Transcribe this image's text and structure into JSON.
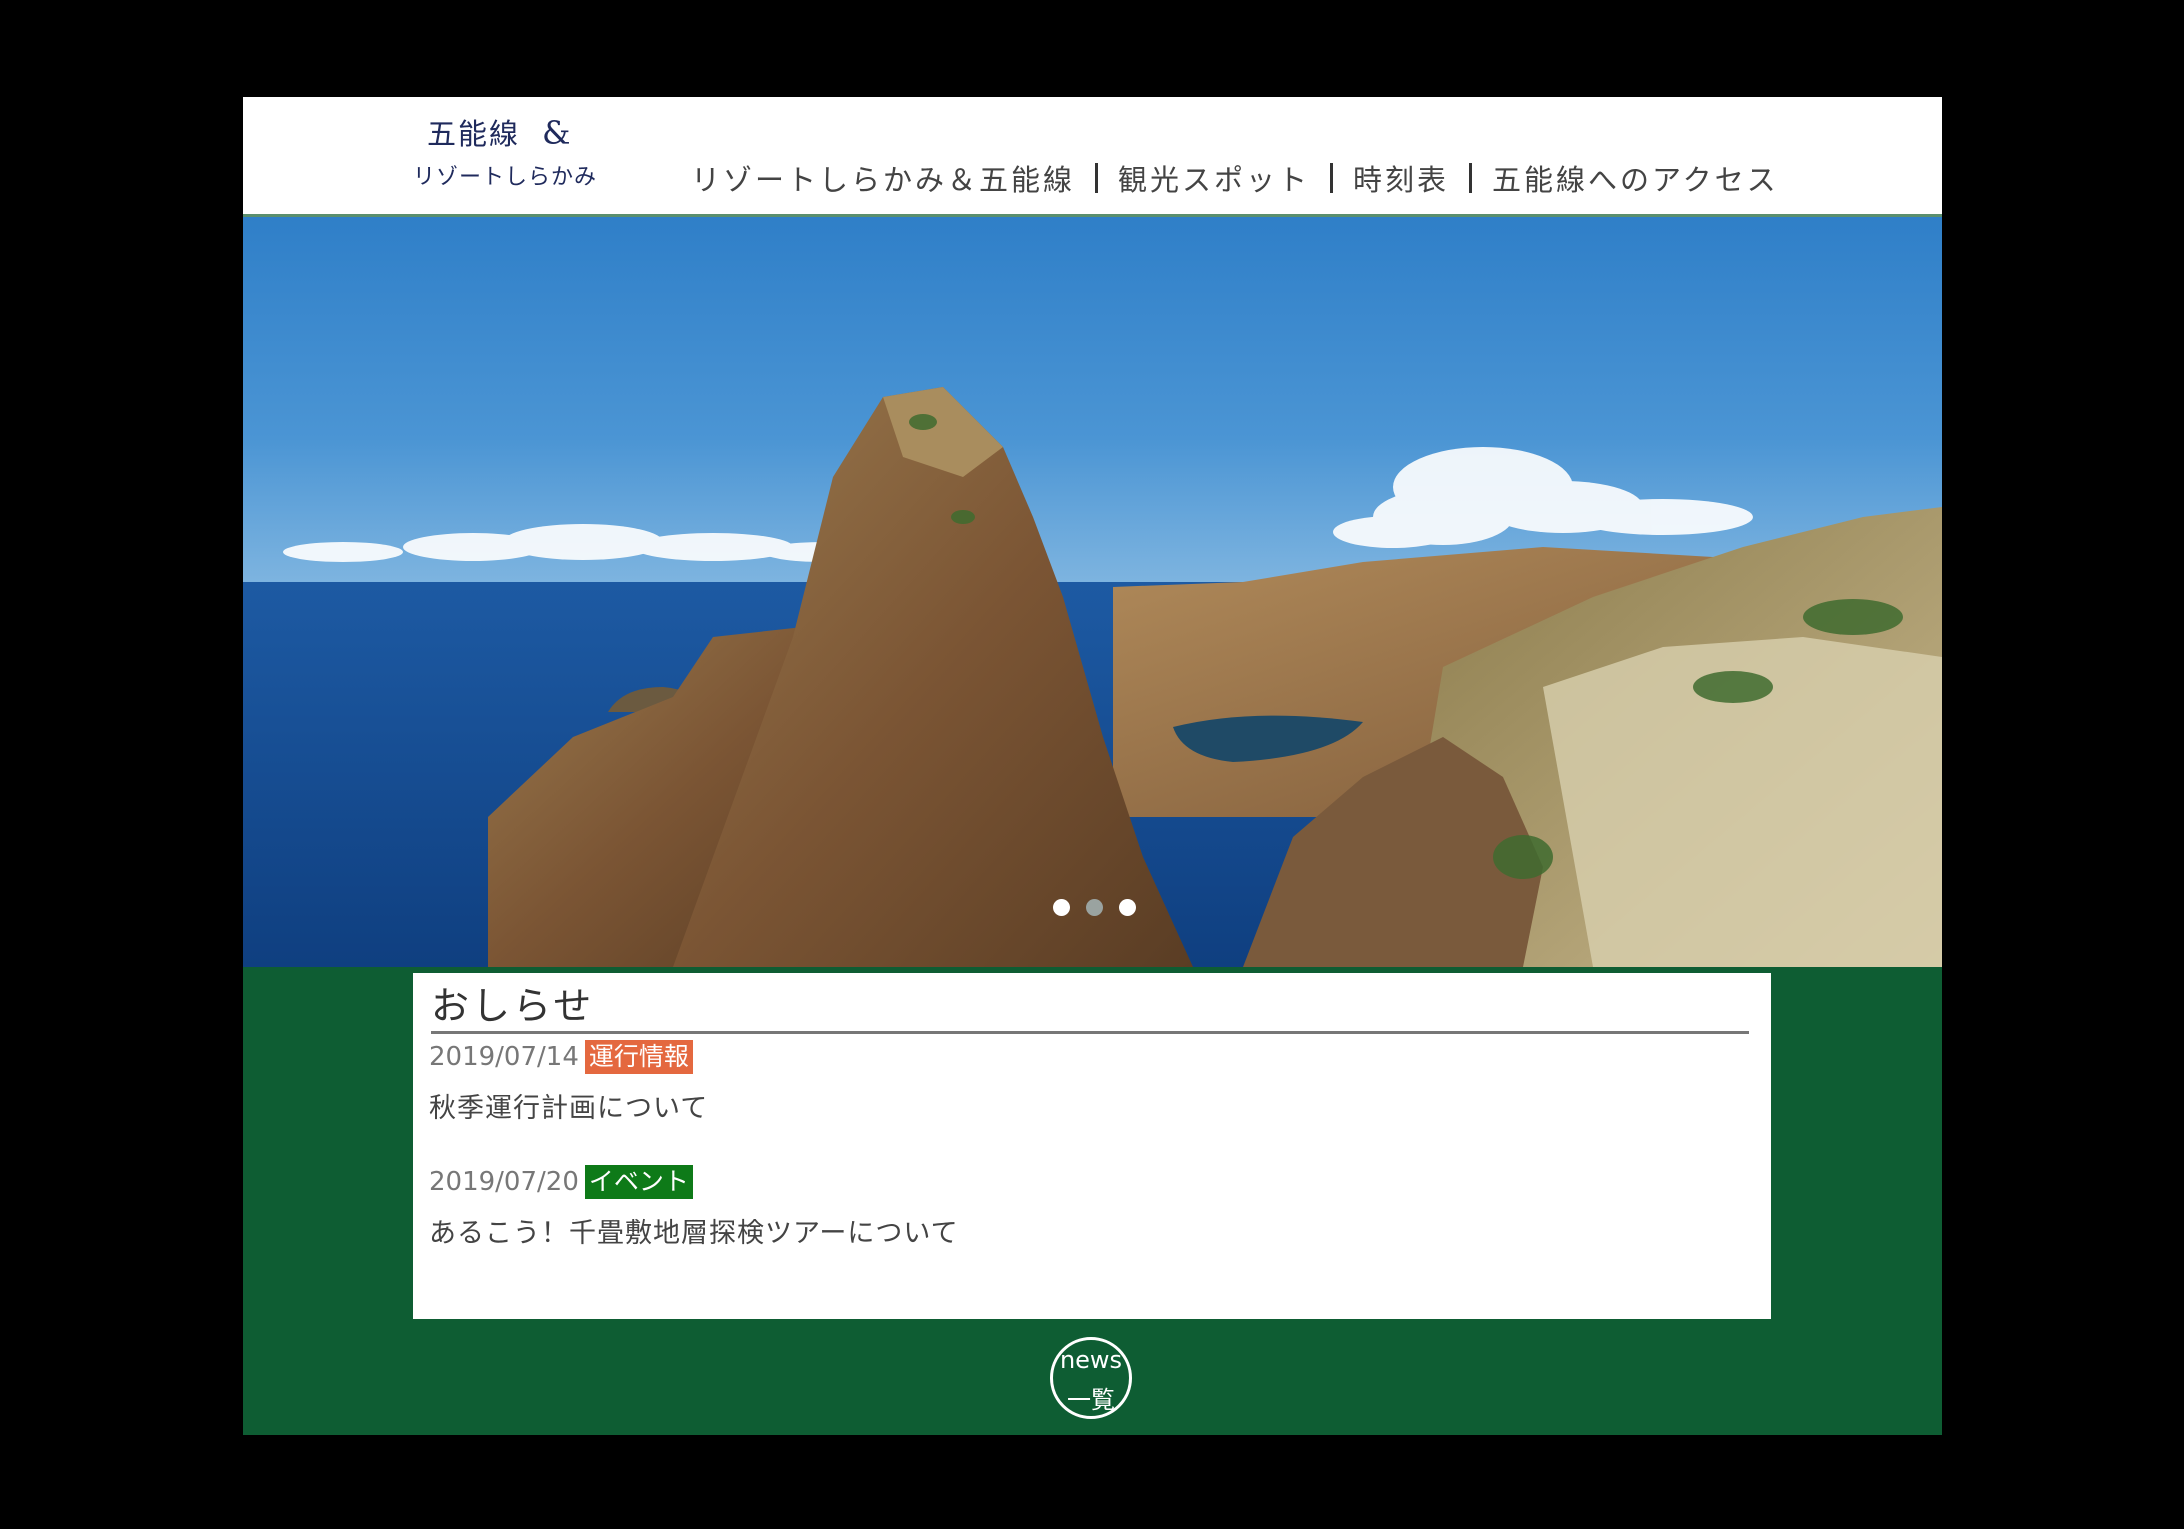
{
  "logo": {
    "line1": "五能線",
    "amp": "&",
    "line2": "リゾートしらかみ"
  },
  "nav": {
    "items": [
      {
        "label": "リゾートしらかみ＆五能線"
      },
      {
        "label": "観光スポット"
      },
      {
        "label": "時刻表"
      },
      {
        "label": "五能線へのアクセス"
      }
    ]
  },
  "carousel": {
    "slide_count": 3,
    "active_index": 0
  },
  "notice": {
    "title": "おしらせ",
    "items": [
      {
        "date": "2019/07/14",
        "tag": "運行情報",
        "tag_color": "#e4683f",
        "text": "秋季運行計画について"
      },
      {
        "date": "2019/07/20",
        "tag": "イベント",
        "tag_color": "#0e7a18",
        "text": "あるこう！千畳敷地層探検ツアーについて"
      }
    ]
  },
  "news_button": {
    "line1": "news",
    "line2": "一覧"
  },
  "colors": {
    "page_bg": "#0e5d33",
    "header_bg": "#ffffff",
    "outer_bg": "#000000"
  }
}
